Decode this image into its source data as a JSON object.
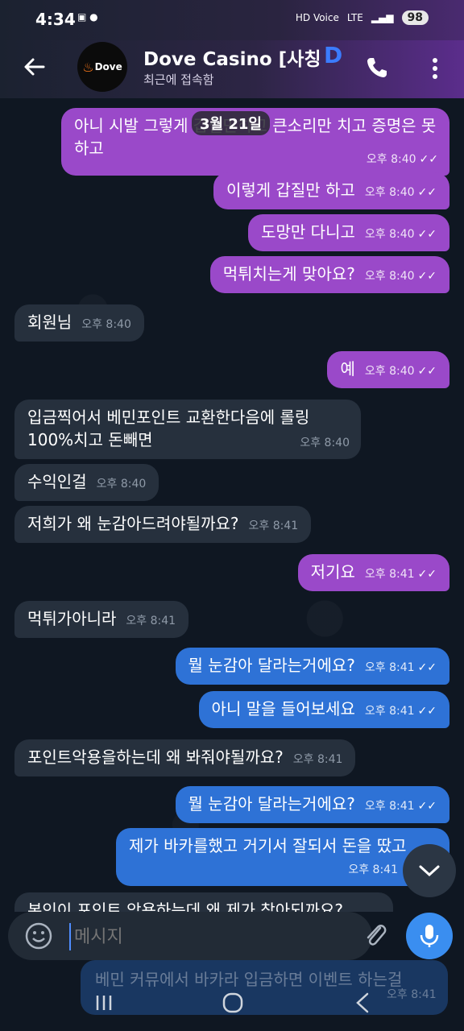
{
  "status_bar": {
    "time": "4:34",
    "left_icons": [
      "screenshot-icon",
      "talk-icon"
    ],
    "network": "LTE",
    "hd_voice": "HD Voice",
    "battery": "98"
  },
  "header": {
    "title": "Dove Casino [사칭",
    "title_suffix": "D",
    "subtitle": "최근에 접속함",
    "avatar_text": "Dove"
  },
  "chat": {
    "date_chip": "3월 21일",
    "messages": [
      {
        "dir": "out",
        "text": "아니 시발 그렇게 갑질만하고 큰소리만 치고 증명은 못하고",
        "time": "오후 8:40"
      },
      {
        "dir": "out",
        "text": "이렇게 갑질만 하고",
        "time": "오후 8:40"
      },
      {
        "dir": "out",
        "text": "도망만 다니고",
        "time": "오후 8:40"
      },
      {
        "dir": "out",
        "text": "먹튀치는게 맞아요?",
        "time": "오후 8:40"
      },
      {
        "dir": "in",
        "text": "회원님",
        "time": "오후 8:40"
      },
      {
        "dir": "out",
        "text": "예",
        "time": "오후 8:40"
      },
      {
        "dir": "in",
        "text": "입금찍어서 베민포인트 교환한다음에 롤링 100%치고 돈빼면",
        "time": "오후 8:40"
      },
      {
        "dir": "in",
        "text": "수익인걸",
        "time": "오후 8:40"
      },
      {
        "dir": "in",
        "text": "저희가 왜 눈감아드려야될까요?",
        "time": "오후 8:41"
      },
      {
        "dir": "out",
        "text": "저기요",
        "time": "오후 8:41"
      },
      {
        "dir": "in",
        "text": "먹튀가아니라",
        "time": "오후 8:41"
      },
      {
        "dir": "out",
        "text": "뭘 눈감아 달라는거에요?",
        "time": "오후 8:41"
      },
      {
        "dir": "out",
        "text": "아니 말을 들어보세요",
        "time": "오후 8:41"
      },
      {
        "dir": "in",
        "text": "포인트악용을하는데 왜 봐줘야될까요?",
        "time": "오후 8:41"
      },
      {
        "dir": "out",
        "text": "뭘 눈감아 달라는거에요?",
        "time": "오후 8:41"
      },
      {
        "dir": "out",
        "text": "제가 바카를했고 거기서 잘되서 돈을 땄고",
        "time": "오후 8:41"
      },
      {
        "dir": "in",
        "text": "본인이 포인트 악용하는데 왜 제가 참아되까요?",
        "time": ""
      }
    ],
    "ghost_message": {
      "text": "베민 커뮤에서 바카라 입금하면 이벤트 하는걸",
      "time": "오후 8:41"
    }
  },
  "input": {
    "placeholder": "메시지"
  },
  "ticks": "✓✓"
}
